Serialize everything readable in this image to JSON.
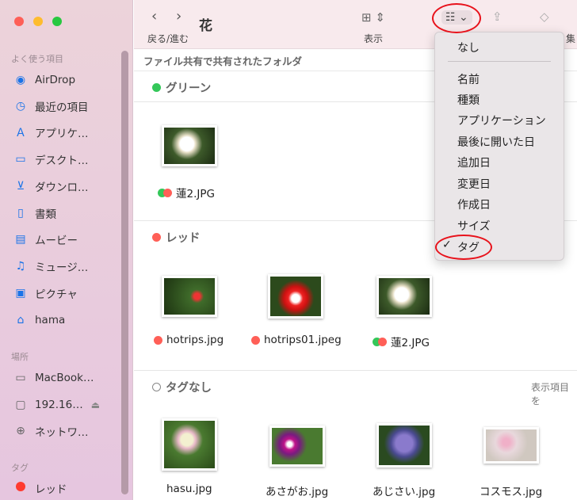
{
  "window": {
    "title": "花"
  },
  "toolbar": {
    "nav_label": "戻る/進む",
    "view_label": "表示",
    "edit_label_partial": "集"
  },
  "path_bar": "ファイル共有で共有されたフォルダ",
  "sidebar": {
    "favorites_header": "よく使う項目",
    "favorites": [
      {
        "label": "AirDrop",
        "icon": "airdrop-icon"
      },
      {
        "label": "最近の項目",
        "icon": "clock-icon"
      },
      {
        "label": "アプリケ…",
        "icon": "applications-icon"
      },
      {
        "label": "デスクト…",
        "icon": "desktop-icon"
      },
      {
        "label": "ダウンロ…",
        "icon": "download-icon"
      },
      {
        "label": "書類",
        "icon": "document-icon"
      },
      {
        "label": "ムービー",
        "icon": "film-icon"
      },
      {
        "label": "ミュージ…",
        "icon": "music-icon"
      },
      {
        "label": "ピクチャ",
        "icon": "photo-icon"
      },
      {
        "label": "hama",
        "icon": "home-icon"
      }
    ],
    "locations_header": "場所",
    "locations": [
      {
        "label": "MacBook…",
        "icon": "laptop-icon"
      },
      {
        "label": "192.16…",
        "icon": "server-icon"
      },
      {
        "label": "ネットワ…",
        "icon": "globe-icon"
      }
    ],
    "tags_header": "タグ",
    "tags": [
      {
        "label": "レッド",
        "color": "#ff3b30"
      }
    ]
  },
  "groups": [
    {
      "title": "グリーン",
      "color": "#34c759",
      "files": [
        {
          "name": "蓮2.JPG",
          "tags": [
            "#34c759",
            "#ff5f57"
          ]
        }
      ]
    },
    {
      "title": "レッド",
      "color": "#ff5f57",
      "files": [
        {
          "name": "hotrips.jpg",
          "tags": [
            "#ff5f57"
          ]
        },
        {
          "name": "hotrips01.jpeg",
          "tags": [
            "#ff5f57"
          ]
        },
        {
          "name": "蓮2.JPG",
          "tags": [
            "#34c759",
            "#ff5f57"
          ]
        }
      ]
    },
    {
      "title": "タグなし",
      "color": "none",
      "action": "表示項目を",
      "files": [
        {
          "name": "hasu.jpg"
        },
        {
          "name": "あさがお.jpg"
        },
        {
          "name": "あじさい.jpg"
        },
        {
          "name": "コスモス.jpg"
        }
      ]
    }
  ],
  "group_menu": {
    "items": [
      "なし",
      "名前",
      "種類",
      "アプリケーション",
      "最後に開いた日",
      "追加日",
      "変更日",
      "作成日",
      "サイズ",
      "タグ"
    ],
    "selected": "タグ"
  }
}
